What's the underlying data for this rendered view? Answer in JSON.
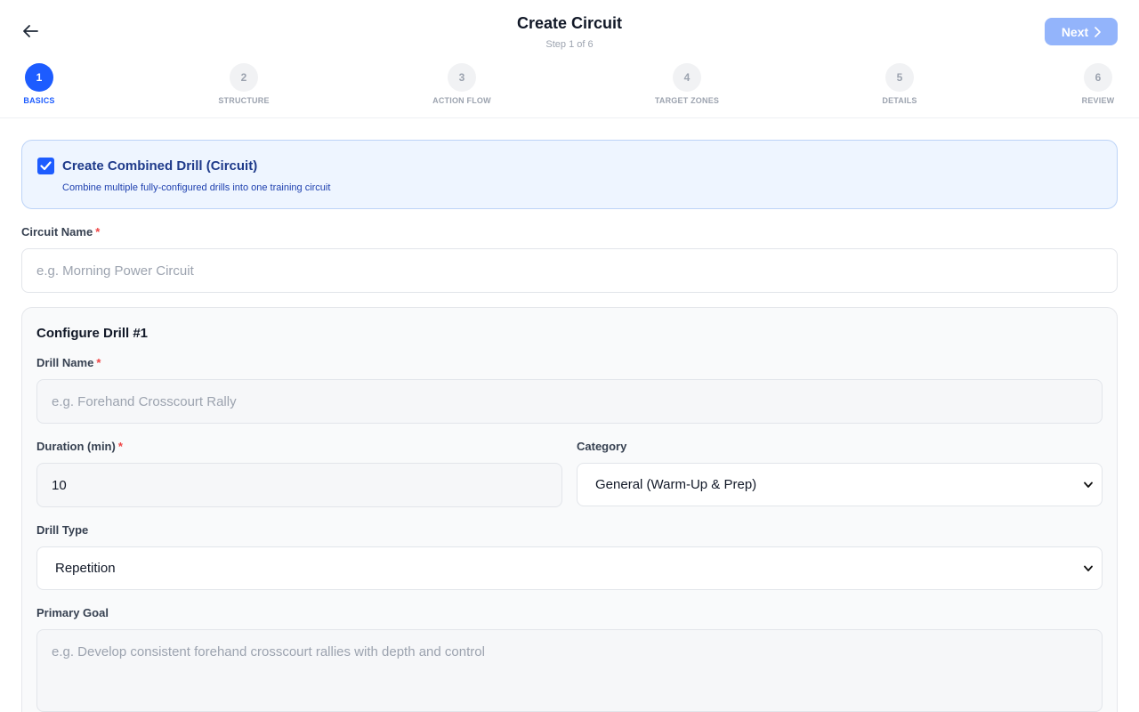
{
  "header": {
    "title": "Create Circuit",
    "subtitle": "Step 1 of 6",
    "back_icon": "arrow-left-icon",
    "next_label": "Next",
    "next_icon": "chevron-right-icon",
    "next_color": "#93b4fb"
  },
  "steps": [
    {
      "number": "1",
      "label": "BASICS",
      "active": true
    },
    {
      "number": "2",
      "label": "STRUCTURE",
      "active": false
    },
    {
      "number": "3",
      "label": "ACTION FLOW",
      "active": false
    },
    {
      "number": "4",
      "label": "TARGET ZONES",
      "active": false
    },
    {
      "number": "5",
      "label": "DETAILS",
      "active": false
    },
    {
      "number": "6",
      "label": "REVIEW",
      "active": false
    }
  ],
  "combined": {
    "checked": true,
    "title": "Create Combined Drill (Circuit)",
    "description": "Combine multiple fully-configured drills into one training circuit"
  },
  "circuit_name": {
    "label": "Circuit Name",
    "required_mark": "*",
    "placeholder": "e.g. Morning Power Circuit",
    "value": ""
  },
  "drill": {
    "title": "Configure Drill #1",
    "name": {
      "label": "Drill Name",
      "required_mark": "*",
      "placeholder": "e.g. Forehand Crosscourt Rally",
      "value": ""
    },
    "duration": {
      "label": "Duration (min)",
      "required_mark": "*",
      "value": "10"
    },
    "category": {
      "label": "Category",
      "selected": "General (Warm-Up & Prep)"
    },
    "drill_type": {
      "label": "Drill Type",
      "selected": "Repetition"
    },
    "primary_goal": {
      "label": "Primary Goal",
      "placeholder": "e.g. Develop consistent forehand crosscourt rallies with depth and control",
      "value": ""
    }
  },
  "colors": {
    "accent": "#1d5cff",
    "required": "#ef4444",
    "info_bg": "#eef5ff"
  }
}
